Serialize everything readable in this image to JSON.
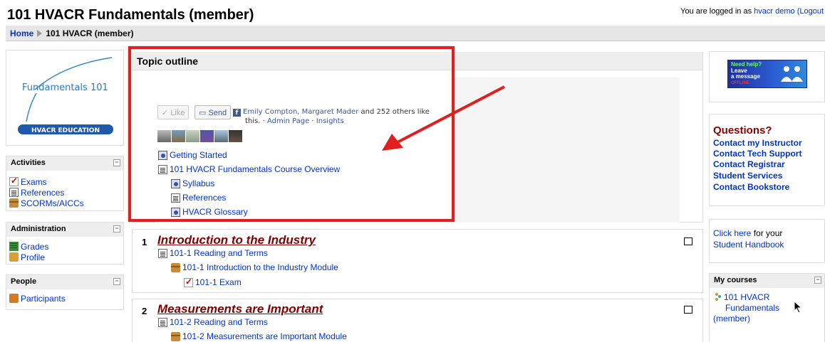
{
  "header": {
    "title": "101 HVACR Fundamentals (member)",
    "login_prefix": "You are logged in as",
    "login_user": "hvacr demo",
    "logout": "(Logout"
  },
  "breadcrumb": {
    "home": "Home",
    "current": "101 HVACR (member)"
  },
  "logo": {
    "line1": "Fundamentals 101",
    "badge": "HVACR EDUCATION"
  },
  "activities": {
    "title": "Activities",
    "items": [
      "Exams",
      "References",
      "SCORMs/AICCs"
    ]
  },
  "administration": {
    "title": "Administration",
    "items": [
      "Grades",
      "Profile"
    ]
  },
  "people": {
    "title": "People",
    "items": [
      "Participants"
    ]
  },
  "topic_outline": {
    "title": "Topic outline",
    "like": "Like",
    "send": "Send",
    "fb_names": "Emily Compton, Margaret Mader",
    "fb_text_rest": "and 252 others like",
    "fb_text_line2": "this.",
    "admin_page": "Admin Page",
    "insights": "Insights",
    "items": [
      {
        "label": "Getting Started",
        "icon": "web-icon"
      },
      {
        "label": "101 HVACR Fundamentals Course Overview",
        "icon": "page-icon"
      },
      {
        "label": "Syllabus",
        "icon": "web-icon"
      },
      {
        "label": "References",
        "icon": "page-icon"
      },
      {
        "label": "HVACR Glossary",
        "icon": "web-icon"
      }
    ]
  },
  "sections": [
    {
      "num": "1",
      "title": "Introduction to the Industry",
      "items": [
        "101-1 Reading and Terms",
        "101-1 Introduction to the Industry Module",
        "101-1 Exam"
      ]
    },
    {
      "num": "2",
      "title": "Measurements are Important",
      "items": [
        "101-2 Reading and Terms",
        "101-2 Measurements are Important Module"
      ]
    }
  ],
  "help_banner": {
    "line1": "Need help?",
    "line2": "Leave",
    "line3": "a message",
    "status": "OFFLINE"
  },
  "questions": {
    "title": "Questions?",
    "links": [
      "Contact my Instructor",
      "Contact Tech Support",
      "Contact Registrar",
      "Student Services",
      "Contact Bookstore"
    ]
  },
  "handbook": {
    "link": "Click here",
    "text1": "for your",
    "text2": "Student Handbook"
  },
  "my_courses": {
    "title": "My courses",
    "line1": "101 HVACR",
    "line2": "Fundamentals",
    "line3": "(member)"
  },
  "colors": {
    "annotation_red": "#e02020",
    "link_blue": "#0033cc",
    "section_title": "#800000",
    "questions_title": "#8b0000"
  }
}
